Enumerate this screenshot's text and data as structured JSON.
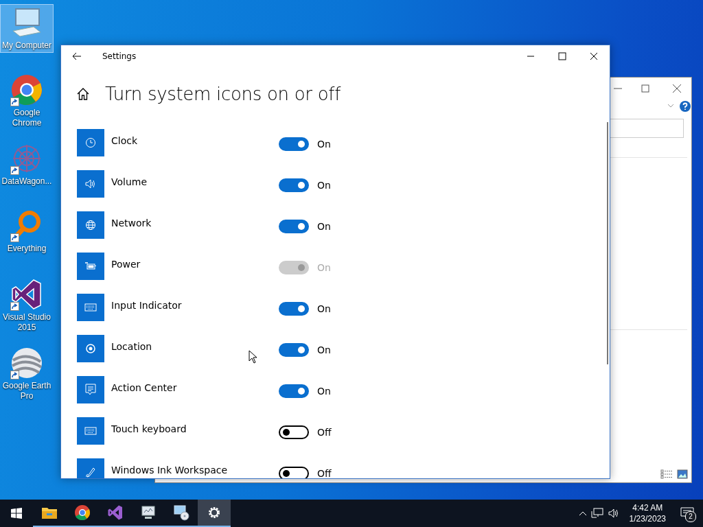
{
  "desktop_icons": [
    {
      "label": "My Computer",
      "kind": "computer",
      "selected": true
    },
    {
      "label": "Google Chrome",
      "kind": "chrome",
      "selected": false
    },
    {
      "label": "DataWagon...",
      "kind": "datawagon",
      "selected": false
    },
    {
      "label": "Everything",
      "kind": "everything",
      "selected": false
    },
    {
      "label": "Visual Studio 2015",
      "kind": "vs",
      "selected": false
    },
    {
      "label": "Google Earth Pro",
      "kind": "earth",
      "selected": false
    }
  ],
  "settings_window": {
    "title": "Settings",
    "heading": "Turn system icons on or off",
    "items": [
      {
        "label": "Clock",
        "kind": "clock",
        "on": true,
        "disabled": false,
        "state_text": "On"
      },
      {
        "label": "Volume",
        "kind": "volume",
        "on": true,
        "disabled": false,
        "state_text": "On"
      },
      {
        "label": "Network",
        "kind": "globe",
        "on": true,
        "disabled": false,
        "state_text": "On"
      },
      {
        "label": "Power",
        "kind": "battery",
        "on": true,
        "disabled": true,
        "state_text": "On"
      },
      {
        "label": "Input Indicator",
        "kind": "keyboard",
        "on": true,
        "disabled": false,
        "state_text": "On"
      },
      {
        "label": "Location",
        "kind": "location",
        "on": true,
        "disabled": false,
        "state_text": "On"
      },
      {
        "label": "Action Center",
        "kind": "message",
        "on": true,
        "disabled": false,
        "state_text": "On"
      },
      {
        "label": "Touch keyboard",
        "kind": "keyboard",
        "on": false,
        "disabled": false,
        "state_text": "Off"
      },
      {
        "label": "Windows Ink Workspace",
        "kind": "pen",
        "on": false,
        "disabled": false,
        "state_text": "Off"
      }
    ]
  },
  "taskbar": {
    "apps": [
      {
        "kind": "folder",
        "selected": false
      },
      {
        "kind": "chrome",
        "selected": false
      },
      {
        "kind": "vs",
        "selected": false
      },
      {
        "kind": "monitor",
        "selected": false
      },
      {
        "kind": "disc",
        "selected": false
      },
      {
        "kind": "gear",
        "selected": true
      }
    ],
    "time": "4:42 AM",
    "date": "1/23/2023",
    "notification_count": "2"
  }
}
